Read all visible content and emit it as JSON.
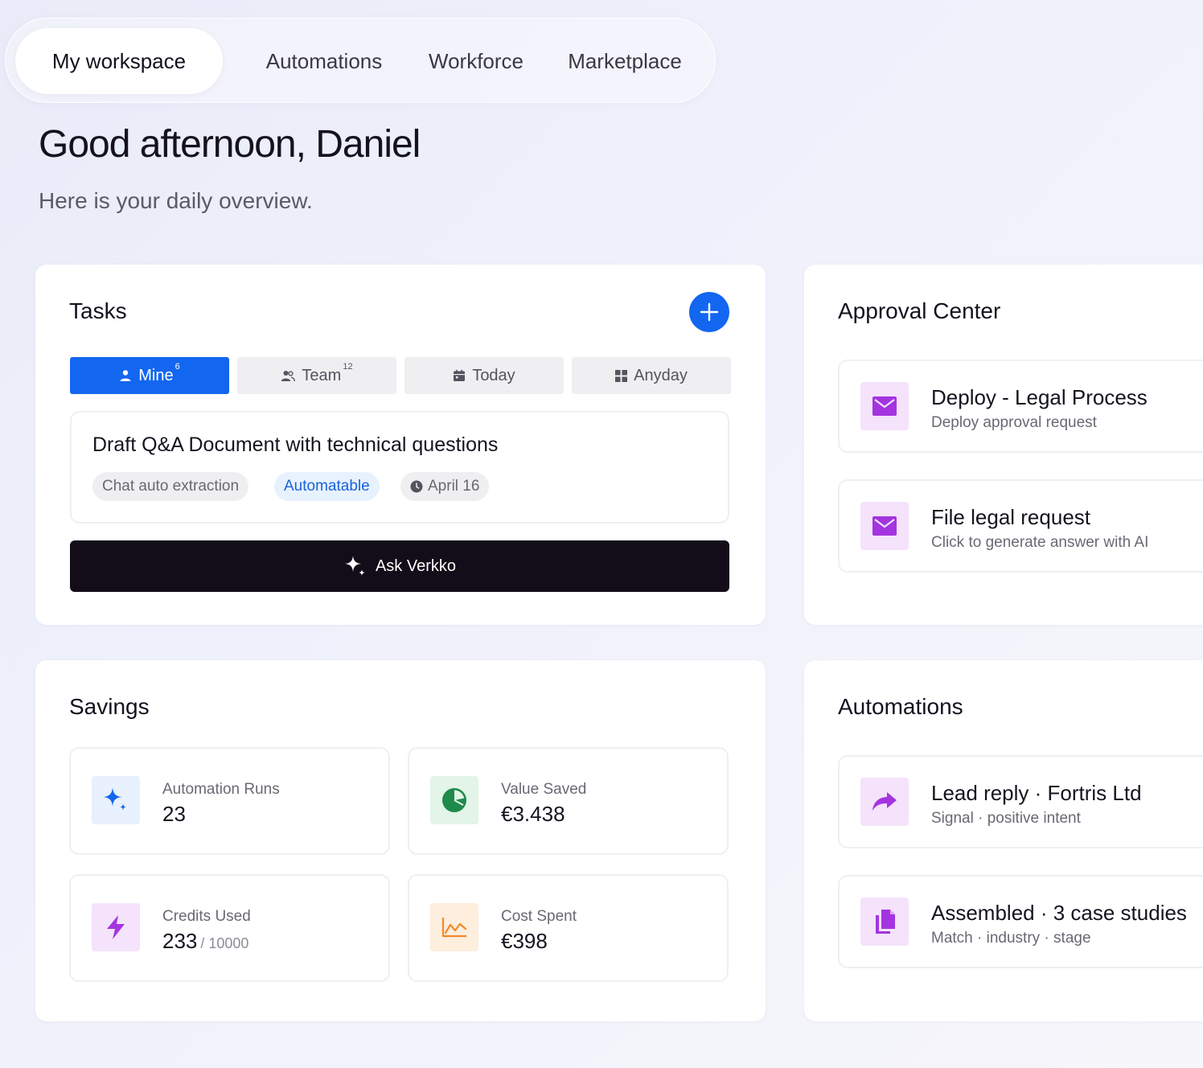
{
  "nav": {
    "tabs": [
      {
        "label": "My workspace",
        "active": true
      },
      {
        "label": "Automations"
      },
      {
        "label": "Workforce"
      },
      {
        "label": "Marketplace"
      }
    ]
  },
  "header": {
    "greeting": "Good afternoon, Daniel",
    "subtitle": "Here is your daily overview."
  },
  "tasks": {
    "title": "Tasks",
    "filters": [
      {
        "label": "Mine",
        "count": "6",
        "icon": "user-icon",
        "active": true
      },
      {
        "label": "Team",
        "count": "12",
        "icon": "users-icon"
      },
      {
        "label": "Today",
        "icon": "calendar-icon"
      },
      {
        "label": "Anyday",
        "icon": "grid-icon"
      }
    ],
    "item": {
      "title": "Draft Q&A Document with technical questions",
      "tags": [
        "Chat auto extraction",
        "Automatable"
      ],
      "date": "April 16"
    },
    "ask_label": "Ask Verkko"
  },
  "approval": {
    "title": "Approval Center",
    "items": [
      {
        "title": "Deploy - Legal Process",
        "subtitle": "Deploy approval request",
        "icon": "mail-icon"
      },
      {
        "title": "File legal request",
        "subtitle": "Click to generate answer with AI",
        "icon": "mail-icon"
      }
    ]
  },
  "savings": {
    "title": "Savings",
    "stats": [
      {
        "label": "Automation Runs",
        "value": "23",
        "icon": "sparkle-icon"
      },
      {
        "label": "Value Saved",
        "value": "€3.438",
        "icon": "pie-chart-icon"
      },
      {
        "label": "Credits Used",
        "value": "233",
        "of": "/ 10000",
        "icon": "bolt-icon"
      },
      {
        "label": "Cost Spent",
        "value": "€398",
        "icon": "line-chart-icon"
      }
    ]
  },
  "automations": {
    "title": "Automations",
    "items": [
      {
        "title": "Lead reply · Fortris Ltd",
        "subtitle": "Signal · positive intent",
        "icon": "share-arrow-icon"
      },
      {
        "title": "Assembled · 3 case studies",
        "subtitle": "Match · industry · stage",
        "icon": "documents-icon"
      }
    ]
  },
  "colors": {
    "primary": "#1366f0",
    "dark": "#120d18",
    "purple": "#a434e0",
    "green": "#1e8a4c",
    "orange": "#f08a2a"
  }
}
